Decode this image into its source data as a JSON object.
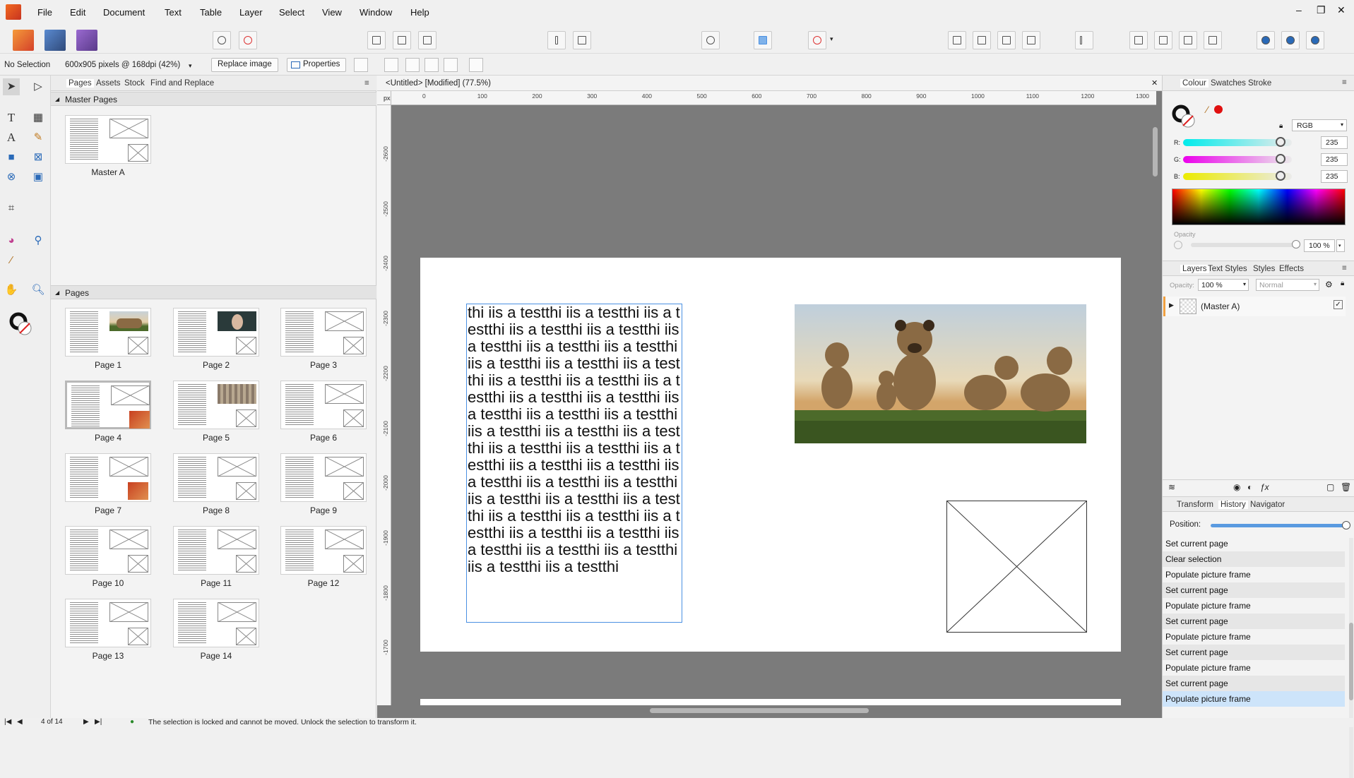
{
  "menu": [
    "File",
    "Edit",
    "Document",
    "Text",
    "Table",
    "Layer",
    "Select",
    "View",
    "Window",
    "Help"
  ],
  "window_controls": [
    "–",
    "❐",
    "✕"
  ],
  "context": {
    "selection": "No Selection",
    "image_info": "600x905 pixels @ 168dpi (42%)",
    "replace_image": "Replace image",
    "properties": "Properties"
  },
  "left_panel": {
    "tabs": [
      "Pages",
      "Assets",
      "Stock",
      "Find and Replace"
    ],
    "master_pages_title": "Master Pages",
    "master_label": "Master A",
    "pages_title": "Pages",
    "pages": [
      "Page 1",
      "Page 2",
      "Page 3",
      "Page 4",
      "Page 5",
      "Page 6",
      "Page 7",
      "Page 8",
      "Page 9",
      "Page 10",
      "Page 11",
      "Page 12",
      "Page 13",
      "Page 14"
    ]
  },
  "document": {
    "tab_title": "<Untitled> [Modified] (77.5%)",
    "close": "✕",
    "ruler_unit": "px",
    "ruler_h": [
      "0",
      "100",
      "200",
      "300",
      "400",
      "500",
      "600",
      "700",
      "800",
      "900",
      "1000",
      "1100",
      "1200",
      "1300"
    ],
    "ruler_v": [
      "-2600",
      "-2500",
      "-2400",
      "-2300",
      "-2200",
      "-2100",
      "-2000",
      "-1900",
      "-1800",
      "-1700"
    ],
    "text_content": "thi iis a testthi iis a testthi iis a testthi iis a testthi iis a testthi iis a testthi iis a testthi iis a testthi iis a testthi iis a testthi iis a testthi iis a testthi iis a testthi iis a testthi iis a testthi iis a testthi iis a testthi iis a testthi iis a testthi iis a testthi iis a testthi iis a testthi iis a testthi iis a testthi iis a testthi iis a testthi iis a testthi iis a testthi iis a testthi iis a testthi iis a testthi iis a testthi iis a testthi iis a testthi iis a testthi iis a testthi iis a testthi iis a testthi iis a testthi iis a testthi iis a testthi iis a testthi iis a testthi"
  },
  "colour_panel": {
    "tabs": [
      "Colour",
      "Swatches",
      "Stroke"
    ],
    "model": "RGB",
    "r_label": "R:",
    "r": "235",
    "g_label": "G:",
    "g": "235",
    "b_label": "B:",
    "b": "235",
    "opacity_label": "Opacity",
    "opacity": "100 %"
  },
  "layers_panel": {
    "tabs": [
      "Layers",
      "Text Styles",
      "Styles",
      "Effects"
    ],
    "opacity_label": "Opacity:",
    "opacity": "100 %",
    "blend": "Normal",
    "layer": "(Master A)"
  },
  "history_panel": {
    "tabs": [
      "Transform",
      "History",
      "Navigator"
    ],
    "position_label": "Position:",
    "items": [
      "Set current page",
      "Clear selection",
      "Populate picture frame",
      "Set current page",
      "Populate picture frame",
      "Set current page",
      "Populate picture frame",
      "Set current page",
      "Populate picture frame",
      "Set current page",
      "Populate picture frame"
    ]
  },
  "status": {
    "page_indicator": "4 of 14",
    "message": "The selection is locked and cannot be moved. Unlock the selection to transform it."
  },
  "colors": {
    "accent": "#4a90e2",
    "history_selected": "#cde4fa",
    "canvas_bg": "#7b7b7b"
  }
}
